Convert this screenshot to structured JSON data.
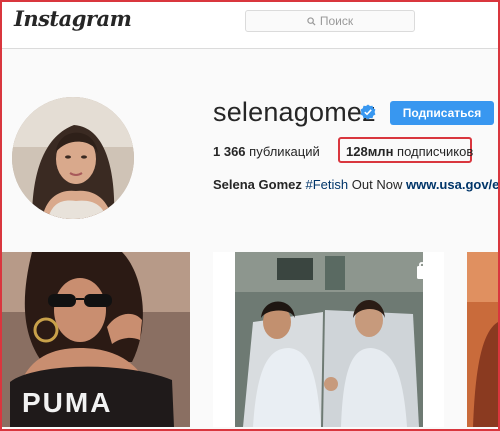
{
  "header": {
    "logo_text": "Instagram",
    "search_placeholder": "Поиск",
    "search_icon": "magnifier-icon"
  },
  "profile": {
    "username": "selenagomez",
    "verified": true,
    "follow_button": "Подписаться",
    "posts_count": "1 366",
    "posts_label": "публикаций",
    "followers_count": "128млн",
    "followers_label": "подписчиков",
    "bio": {
      "name": "Selena Gomez",
      "hashtag": "#Fetish",
      "text": "Out Now",
      "link": "www.usa.gov/elec"
    }
  },
  "posts": [
    {
      "text": "PUMA",
      "type": "photo"
    },
    {
      "type": "multi-photo"
    },
    {
      "type": "photo"
    }
  ],
  "colors": {
    "accent": "#3897f0",
    "highlight": "#d9363e",
    "link": "#003569"
  }
}
